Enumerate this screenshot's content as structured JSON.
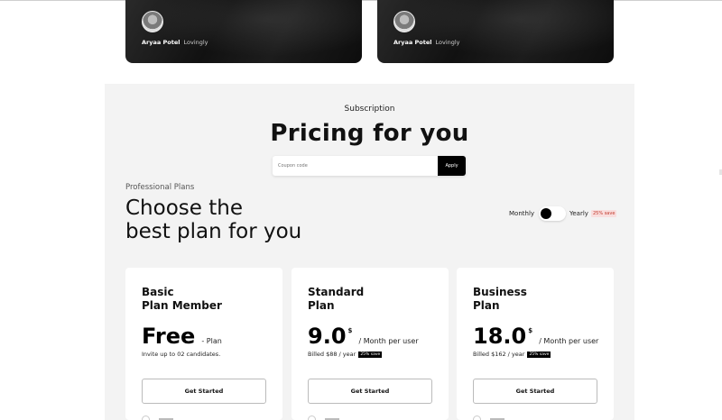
{
  "testimonials": [
    {
      "name": "Aryaa Potel",
      "tag": "Lovingly"
    },
    {
      "name": "Aryaa Potel",
      "tag": "Lovingly"
    }
  ],
  "pricing": {
    "eyebrow": "Subscription",
    "title": "Pricing for you",
    "coupon_placeholder": "Coupon code",
    "apply_label": "Apply",
    "section_label": "Professional Plans",
    "headline_line1": "Choose the",
    "headline_line2": "best plan for you",
    "billing": {
      "monthly_label": "Monthly",
      "yearly_label": "Yearly",
      "save_label": "25% save",
      "selected": "Monthly"
    },
    "plans": [
      {
        "name_line1": "Basic",
        "name_line2": "Plan Member",
        "price": "Free",
        "currency": "",
        "period": "- Plan",
        "subtext": "Invite up to 02 candidates.",
        "badge": "",
        "button_label": "Get Started"
      },
      {
        "name_line1": "Standard",
        "name_line2": "Plan",
        "price": "9.0",
        "currency": "$",
        "period": "/ Month per user",
        "subtext": "Billed $88 / year",
        "badge": "25% save",
        "button_label": "Get Started"
      },
      {
        "name_line1": "Business",
        "name_line2": "Plan",
        "price": "18.0",
        "currency": "$",
        "period": "/ Month per user",
        "subtext": "Billed $162 / year",
        "badge": "25% save",
        "button_label": "Get Started"
      }
    ]
  },
  "colors": {
    "accent": "#000000",
    "section_bg": "#f3f3f3",
    "save_badge_bg": "#f9dede",
    "save_badge_text": "#c0392b"
  }
}
